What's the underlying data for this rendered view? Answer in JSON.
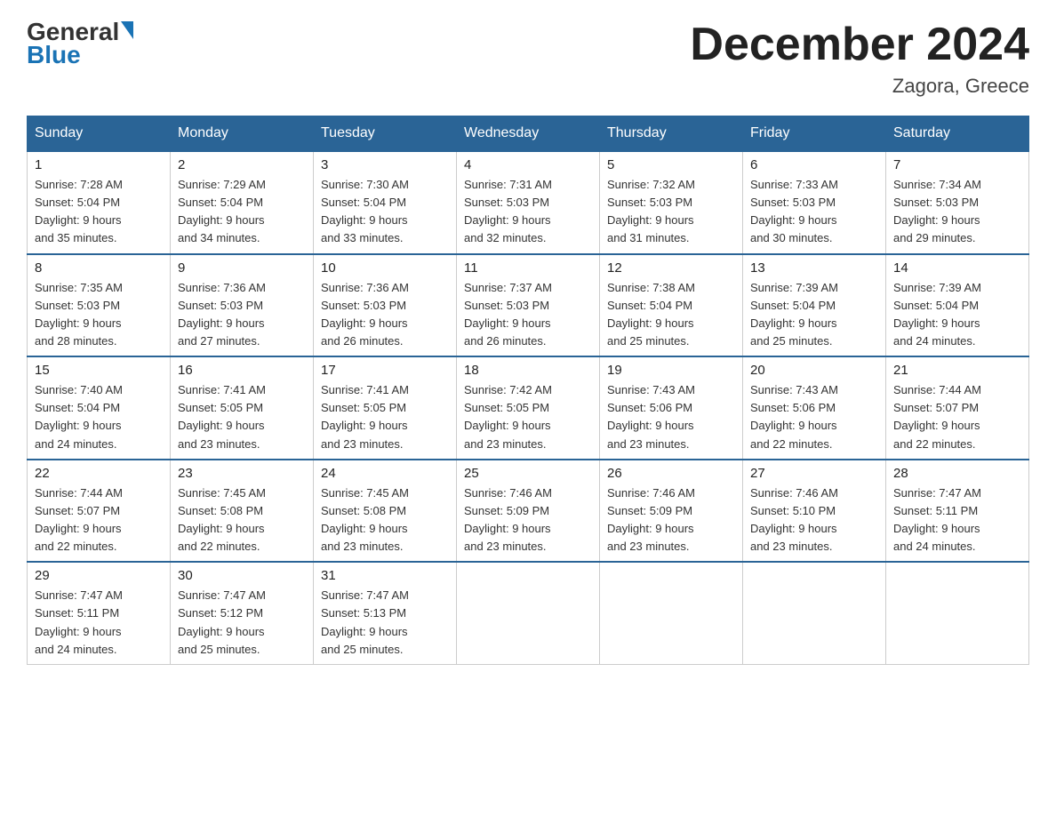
{
  "header": {
    "logo_general": "General",
    "logo_blue": "Blue",
    "month_title": "December 2024",
    "location": "Zagora, Greece"
  },
  "weekdays": [
    "Sunday",
    "Monday",
    "Tuesday",
    "Wednesday",
    "Thursday",
    "Friday",
    "Saturday"
  ],
  "weeks": [
    [
      {
        "day": "1",
        "sunrise": "7:28 AM",
        "sunset": "5:04 PM",
        "daylight": "9 hours and 35 minutes."
      },
      {
        "day": "2",
        "sunrise": "7:29 AM",
        "sunset": "5:04 PM",
        "daylight": "9 hours and 34 minutes."
      },
      {
        "day": "3",
        "sunrise": "7:30 AM",
        "sunset": "5:04 PM",
        "daylight": "9 hours and 33 minutes."
      },
      {
        "day": "4",
        "sunrise": "7:31 AM",
        "sunset": "5:03 PM",
        "daylight": "9 hours and 32 minutes."
      },
      {
        "day": "5",
        "sunrise": "7:32 AM",
        "sunset": "5:03 PM",
        "daylight": "9 hours and 31 minutes."
      },
      {
        "day": "6",
        "sunrise": "7:33 AM",
        "sunset": "5:03 PM",
        "daylight": "9 hours and 30 minutes."
      },
      {
        "day": "7",
        "sunrise": "7:34 AM",
        "sunset": "5:03 PM",
        "daylight": "9 hours and 29 minutes."
      }
    ],
    [
      {
        "day": "8",
        "sunrise": "7:35 AM",
        "sunset": "5:03 PM",
        "daylight": "9 hours and 28 minutes."
      },
      {
        "day": "9",
        "sunrise": "7:36 AM",
        "sunset": "5:03 PM",
        "daylight": "9 hours and 27 minutes."
      },
      {
        "day": "10",
        "sunrise": "7:36 AM",
        "sunset": "5:03 PM",
        "daylight": "9 hours and 26 minutes."
      },
      {
        "day": "11",
        "sunrise": "7:37 AM",
        "sunset": "5:03 PM",
        "daylight": "9 hours and 26 minutes."
      },
      {
        "day": "12",
        "sunrise": "7:38 AM",
        "sunset": "5:04 PM",
        "daylight": "9 hours and 25 minutes."
      },
      {
        "day": "13",
        "sunrise": "7:39 AM",
        "sunset": "5:04 PM",
        "daylight": "9 hours and 25 minutes."
      },
      {
        "day": "14",
        "sunrise": "7:39 AM",
        "sunset": "5:04 PM",
        "daylight": "9 hours and 24 minutes."
      }
    ],
    [
      {
        "day": "15",
        "sunrise": "7:40 AM",
        "sunset": "5:04 PM",
        "daylight": "9 hours and 24 minutes."
      },
      {
        "day": "16",
        "sunrise": "7:41 AM",
        "sunset": "5:05 PM",
        "daylight": "9 hours and 23 minutes."
      },
      {
        "day": "17",
        "sunrise": "7:41 AM",
        "sunset": "5:05 PM",
        "daylight": "9 hours and 23 minutes."
      },
      {
        "day": "18",
        "sunrise": "7:42 AM",
        "sunset": "5:05 PM",
        "daylight": "9 hours and 23 minutes."
      },
      {
        "day": "19",
        "sunrise": "7:43 AM",
        "sunset": "5:06 PM",
        "daylight": "9 hours and 23 minutes."
      },
      {
        "day": "20",
        "sunrise": "7:43 AM",
        "sunset": "5:06 PM",
        "daylight": "9 hours and 22 minutes."
      },
      {
        "day": "21",
        "sunrise": "7:44 AM",
        "sunset": "5:07 PM",
        "daylight": "9 hours and 22 minutes."
      }
    ],
    [
      {
        "day": "22",
        "sunrise": "7:44 AM",
        "sunset": "5:07 PM",
        "daylight": "9 hours and 22 minutes."
      },
      {
        "day": "23",
        "sunrise": "7:45 AM",
        "sunset": "5:08 PM",
        "daylight": "9 hours and 22 minutes."
      },
      {
        "day": "24",
        "sunrise": "7:45 AM",
        "sunset": "5:08 PM",
        "daylight": "9 hours and 23 minutes."
      },
      {
        "day": "25",
        "sunrise": "7:46 AM",
        "sunset": "5:09 PM",
        "daylight": "9 hours and 23 minutes."
      },
      {
        "day": "26",
        "sunrise": "7:46 AM",
        "sunset": "5:09 PM",
        "daylight": "9 hours and 23 minutes."
      },
      {
        "day": "27",
        "sunrise": "7:46 AM",
        "sunset": "5:10 PM",
        "daylight": "9 hours and 23 minutes."
      },
      {
        "day": "28",
        "sunrise": "7:47 AM",
        "sunset": "5:11 PM",
        "daylight": "9 hours and 24 minutes."
      }
    ],
    [
      {
        "day": "29",
        "sunrise": "7:47 AM",
        "sunset": "5:11 PM",
        "daylight": "9 hours and 24 minutes."
      },
      {
        "day": "30",
        "sunrise": "7:47 AM",
        "sunset": "5:12 PM",
        "daylight": "9 hours and 25 minutes."
      },
      {
        "day": "31",
        "sunrise": "7:47 AM",
        "sunset": "5:13 PM",
        "daylight": "9 hours and 25 minutes."
      },
      null,
      null,
      null,
      null
    ]
  ]
}
